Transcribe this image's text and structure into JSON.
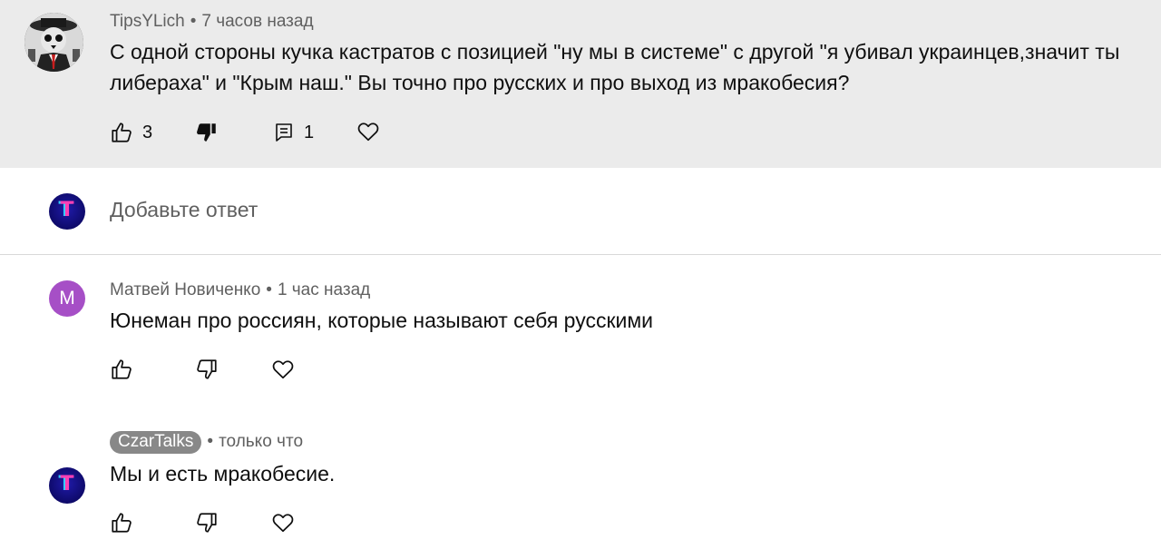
{
  "comment1": {
    "author": "TipsYLich",
    "time": "7 часов назад",
    "text": "С одной стороны кучка кастратов с позицией \"ну мы в системе\" с другой \"я убивал украинцев,значит ты либераха\" и \"Крым наш.\" Вы точно про русских и про выход из мракобесия?",
    "likes": "3",
    "replies": "1"
  },
  "reply_box": {
    "placeholder": "Добавьте ответ",
    "avatar_letter": "T"
  },
  "comment2": {
    "author": "Матвей Новиченко",
    "time": "1 час назад",
    "text": "Юнеман про россиян, которые называют себя русскими",
    "avatar_letter": "М"
  },
  "comment3": {
    "author": "CzarTalks",
    "time": "только что",
    "text": "Мы и есть мракобесие.",
    "avatar_letter": "T"
  },
  "separator": "•",
  "colors": {
    "highlight_bg": "#ebebeb",
    "matvey_avatar": "#a64fc6",
    "chip_bg": "#888888",
    "meta_text": "#606060"
  }
}
